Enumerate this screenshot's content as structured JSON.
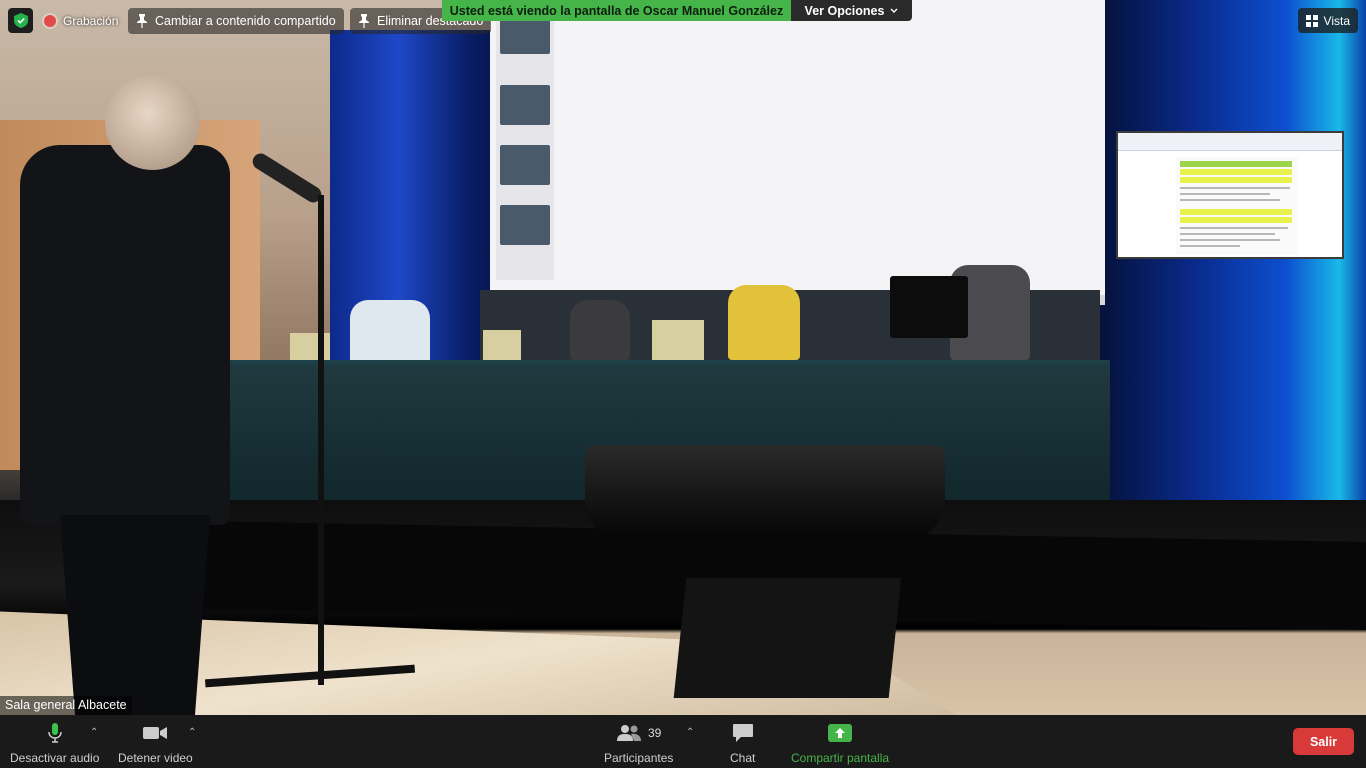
{
  "top_bar": {
    "recording_label": "Grabación",
    "switch_content_label": "Cambiar a contenido compartido",
    "remove_spotlight_label": "Eliminar destacado",
    "view_label": "Vista",
    "security_icon": "shield-check-icon",
    "recording_icon": "record-dot-icon",
    "pin_icon": "pin-icon",
    "view_icon": "grid-icon"
  },
  "share_banner": {
    "message": "Usted está viendo la pantalla de Oscar Manuel González",
    "options_label": "Ver Opciones",
    "banner_color": "#45b549"
  },
  "video": {
    "participant_name": "Sala general Albacete"
  },
  "toolbar": {
    "mute_label": "Desactivar audio",
    "stop_video_label": "Detener video",
    "participants_label": "Participantes",
    "participants_count": "39",
    "chat_label": "Chat",
    "share_label": "Compartir pantalla",
    "leave_label": "Salir",
    "share_color": "#45b549",
    "leave_color": "#d83a3a",
    "icons": {
      "mute": "microphone-icon",
      "video": "video-camera-icon",
      "participants": "participants-icon",
      "chat": "chat-bubble-icon",
      "share": "share-screen-icon"
    }
  }
}
